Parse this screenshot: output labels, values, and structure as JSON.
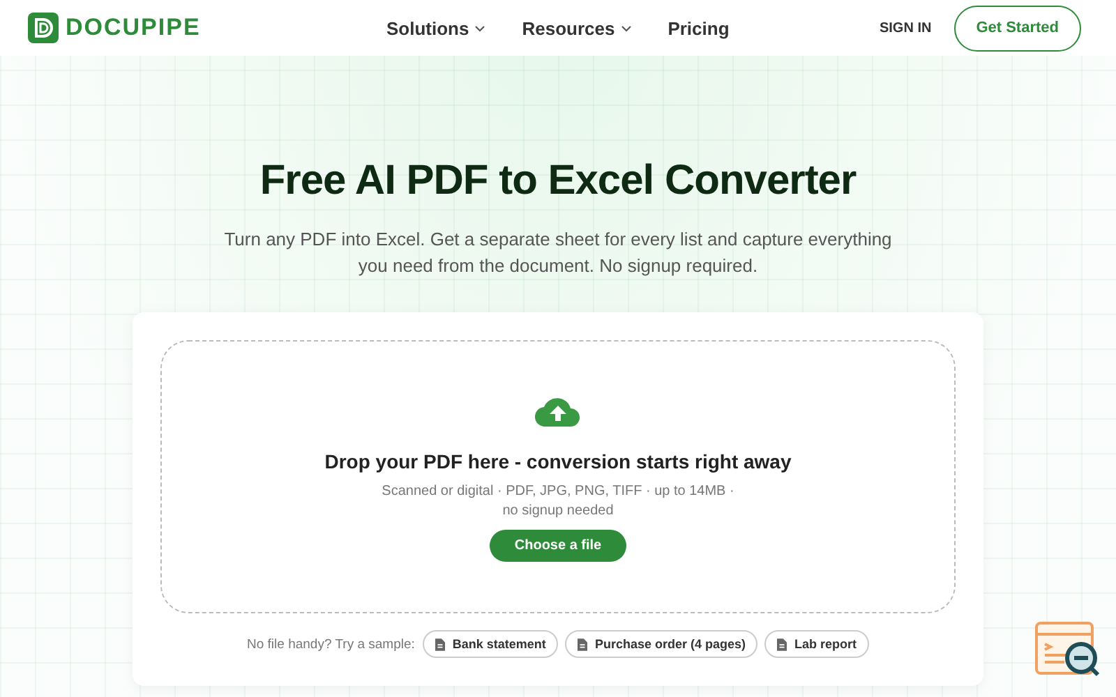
{
  "nav": {
    "brand": "DOCUPIPE",
    "menu": [
      {
        "label": "Solutions",
        "dropdown": true
      },
      {
        "label": "Resources",
        "dropdown": true
      },
      {
        "label": "Pricing",
        "dropdown": false
      }
    ],
    "sign_in": "SIGN IN",
    "cta": "Get Started"
  },
  "hero": {
    "title": "Free AI PDF to Excel Converter",
    "subtitle": "Turn any PDF into Excel. Get a separate sheet for every list and capture everything you need from the document. No signup required."
  },
  "dropzone": {
    "heading": "Drop your PDF here - conversion starts right away",
    "hint_line_1": "Scanned or digital · PDF, JPG, PNG, TIFF · up to 14MB ·",
    "hint_line_2": "no signup needed",
    "button": "Choose a file"
  },
  "samples": {
    "label": "No file handy? Try a sample:",
    "items": [
      "Bank statement",
      "Purchase order (4 pages)",
      "Lab report"
    ]
  }
}
